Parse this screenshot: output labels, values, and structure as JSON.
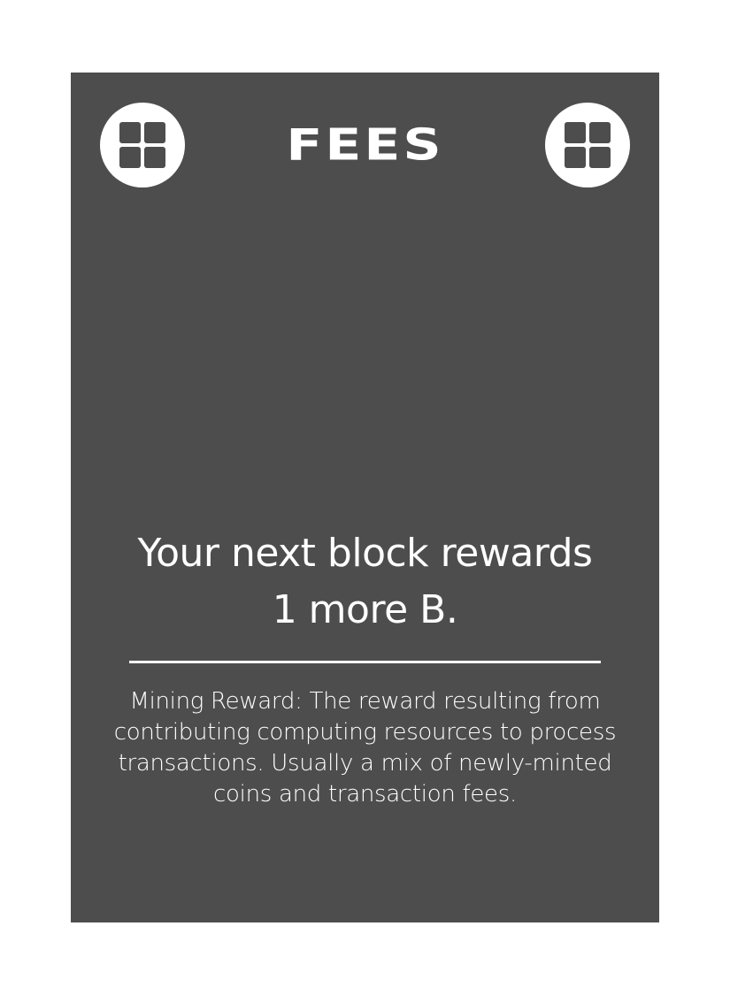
{
  "card": {
    "title": "FEES",
    "headline_line1": "Your next block rewards",
    "headline_line2": "1 more B.",
    "definition": "Mining Reward: The reward resulting from contributing computing resources to process transactions. Usually a mix of newly-minted coins and transaction fees.",
    "background_color": "#4d4d4d",
    "text_color": "#ffffff",
    "corner_icons": [
      "grid-icon",
      "grid-icon"
    ]
  }
}
